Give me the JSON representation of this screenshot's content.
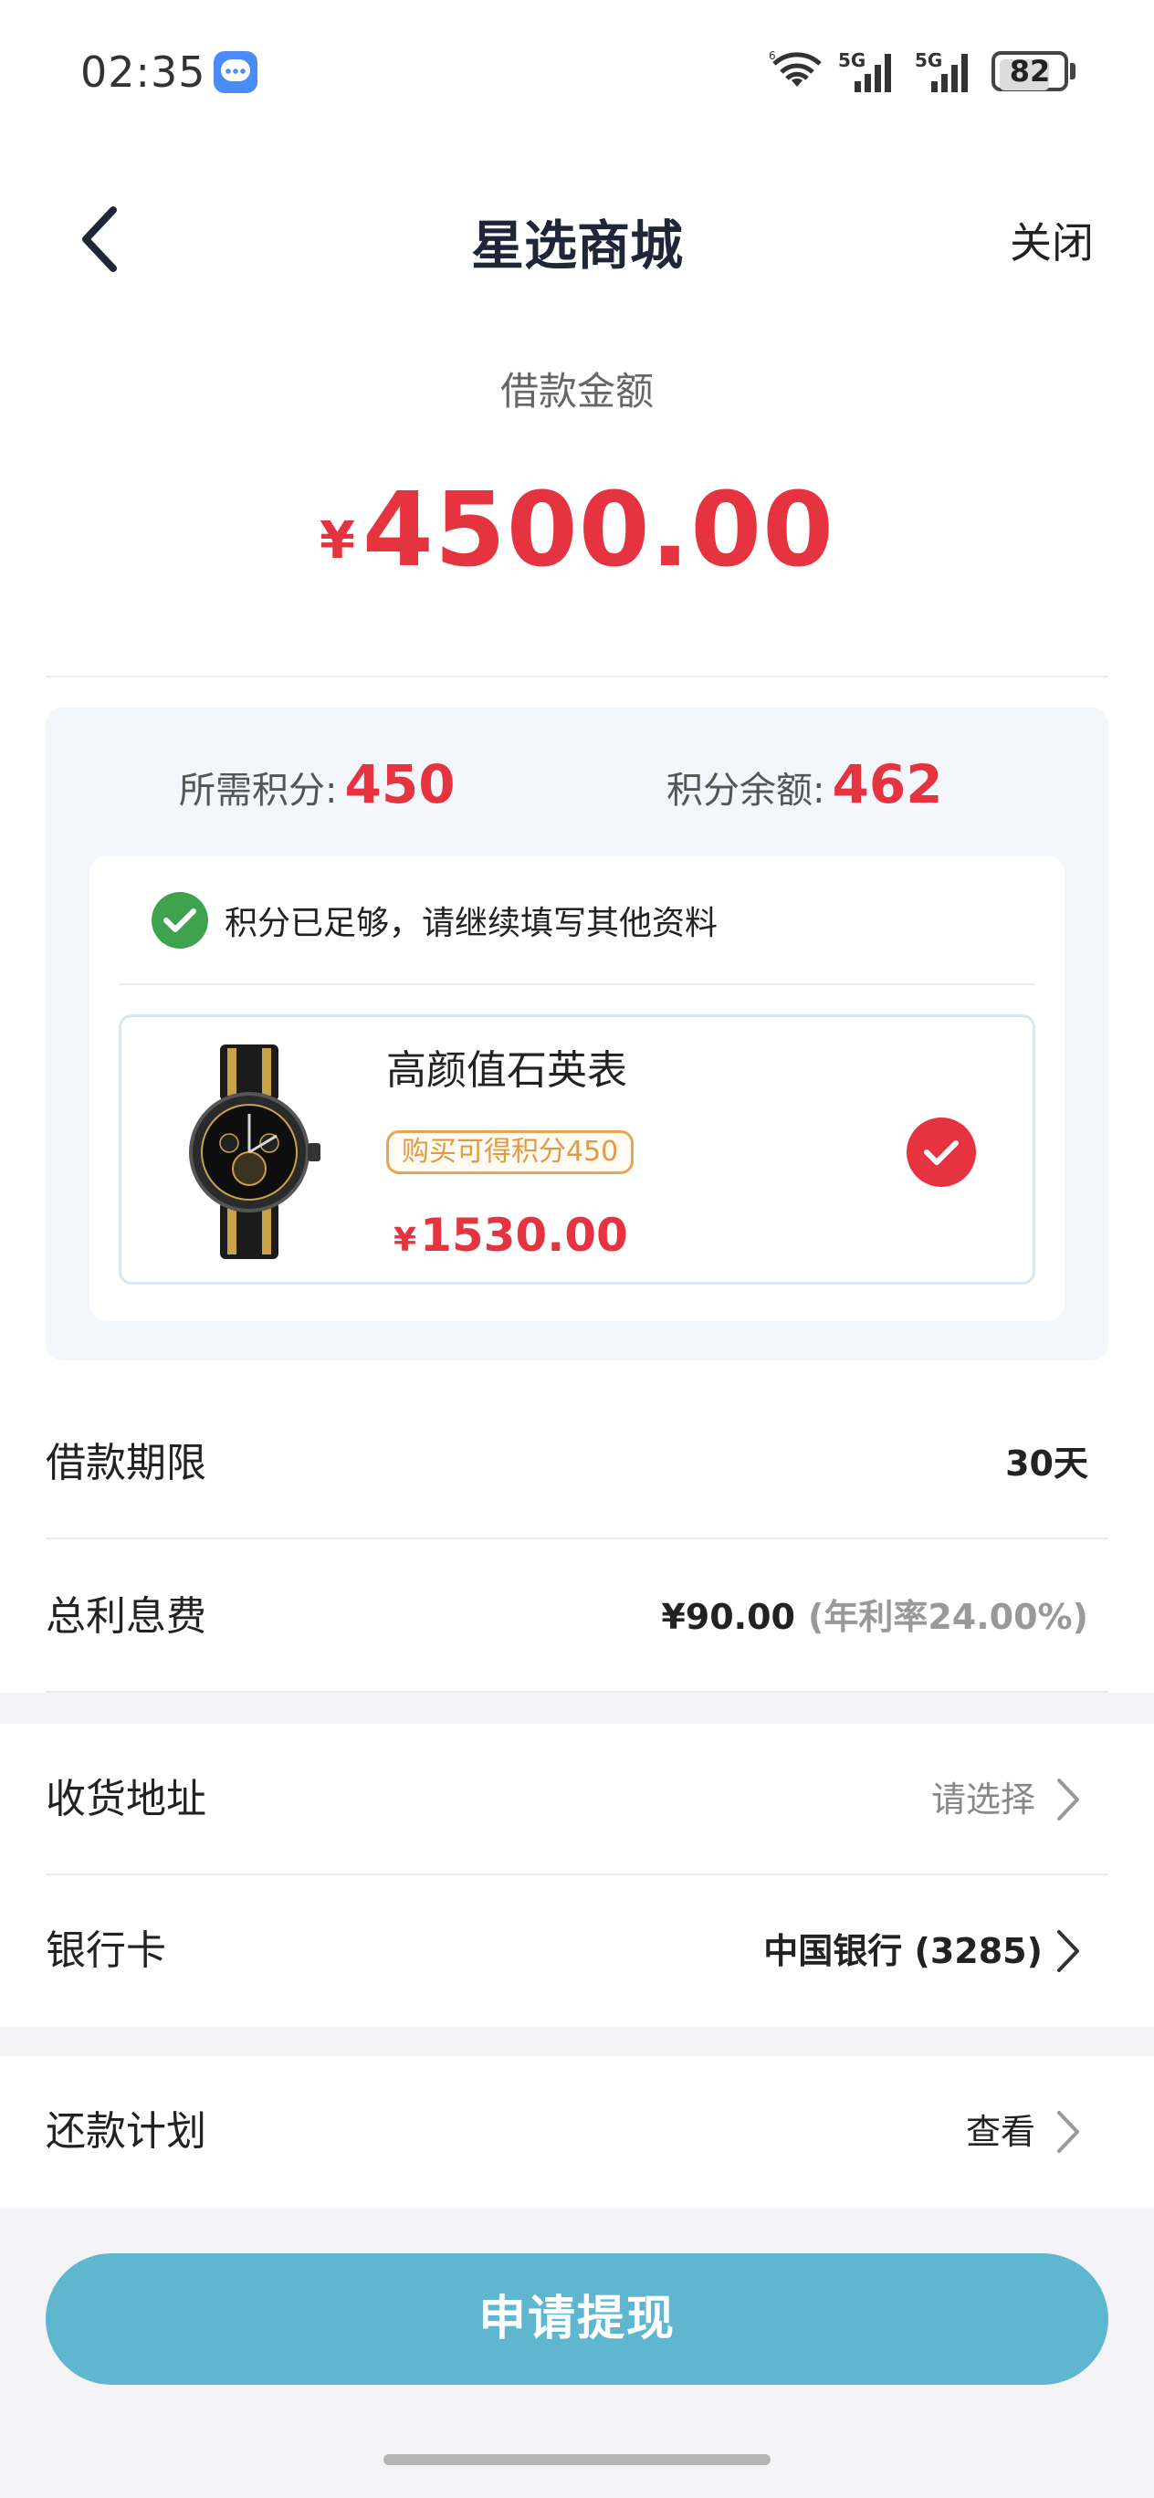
{
  "status_bar": {
    "time": "02:35",
    "battery": "82",
    "battery_level": 0.82,
    "network_1": "5G",
    "network_2": "5G"
  },
  "nav": {
    "title": "星选商城",
    "close": "关闭"
  },
  "loan": {
    "label": "借款金额",
    "currency": "¥",
    "amount": "4500.00"
  },
  "points": {
    "required_label": "所需积分:",
    "required_value": "450",
    "balance_label": "积分余额:",
    "balance_value": "462",
    "status_text": "积分已足够，请继续填写其他资料"
  },
  "product": {
    "name": "高颜值石英表",
    "tag": "购买可得积分450",
    "currency": "¥",
    "price": "1530.00"
  },
  "rows": {
    "term_label": "借款期限",
    "term_value": "30天",
    "interest_label": "总利息费",
    "interest_value": "¥90.00",
    "interest_rate": "(年利率24.00%)",
    "address_label": "收货地址",
    "address_value": "请选择",
    "bank_label": "银行卡",
    "bank_value": "中国银行 (3285)",
    "plan_label": "还款计划",
    "plan_value": "查看"
  },
  "apply_button": "申请提现",
  "colors": {
    "accent_red": "#e63340",
    "button_blue": "#5fb7cf",
    "success_green": "#3fa34d",
    "tag_orange": "#e29a40"
  }
}
